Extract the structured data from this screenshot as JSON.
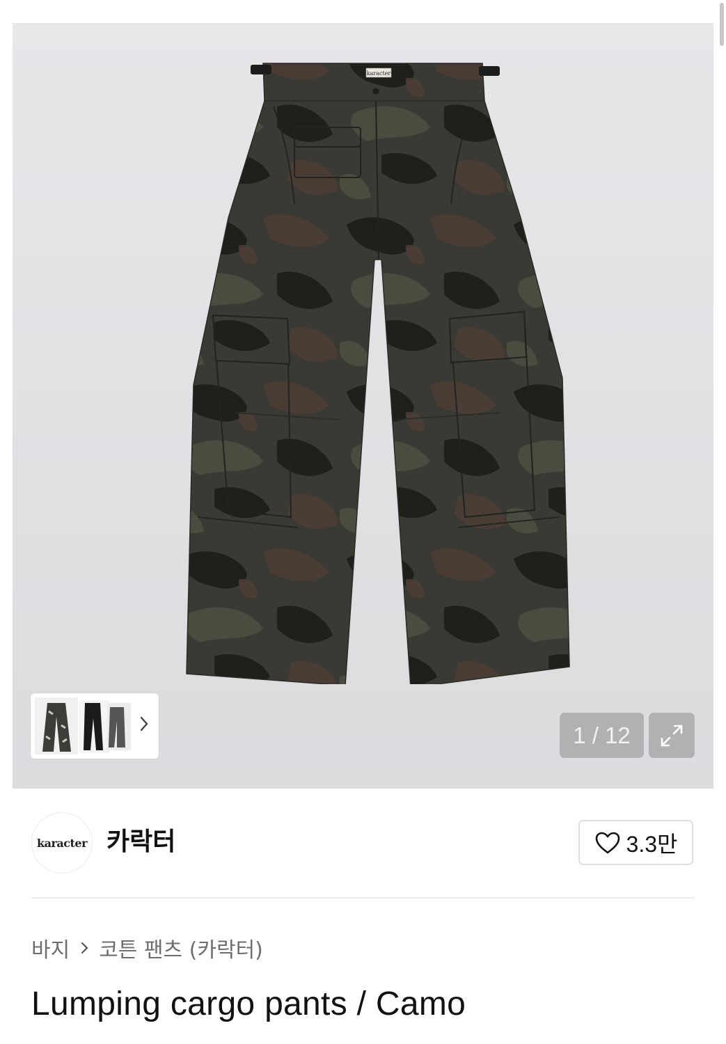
{
  "gallery": {
    "current_page": "1",
    "total_pages": "12",
    "page_indicator": "1 / 12",
    "background_color": "#e3e3e6",
    "thumbnails": [
      "camo-pants-thumbnail",
      "black-pants-thumbnail",
      "gray-pants-thumbnail"
    ]
  },
  "brand": {
    "logo_text": "karacter",
    "name": "카락터",
    "like_count": "3.3만"
  },
  "breadcrumb": {
    "category": "바지",
    "subcategory": "코튼 팬츠 (카락터)"
  },
  "product": {
    "title": "Lumping cargo pants / Camo",
    "label_text": "karacter"
  },
  "colors": {
    "camo_base": "#3b3a34",
    "camo_dark": "#1f1f1c",
    "camo_brown": "#4a3d35",
    "camo_olive": "#4b4b40",
    "text_secondary": "#6d6d6d"
  }
}
